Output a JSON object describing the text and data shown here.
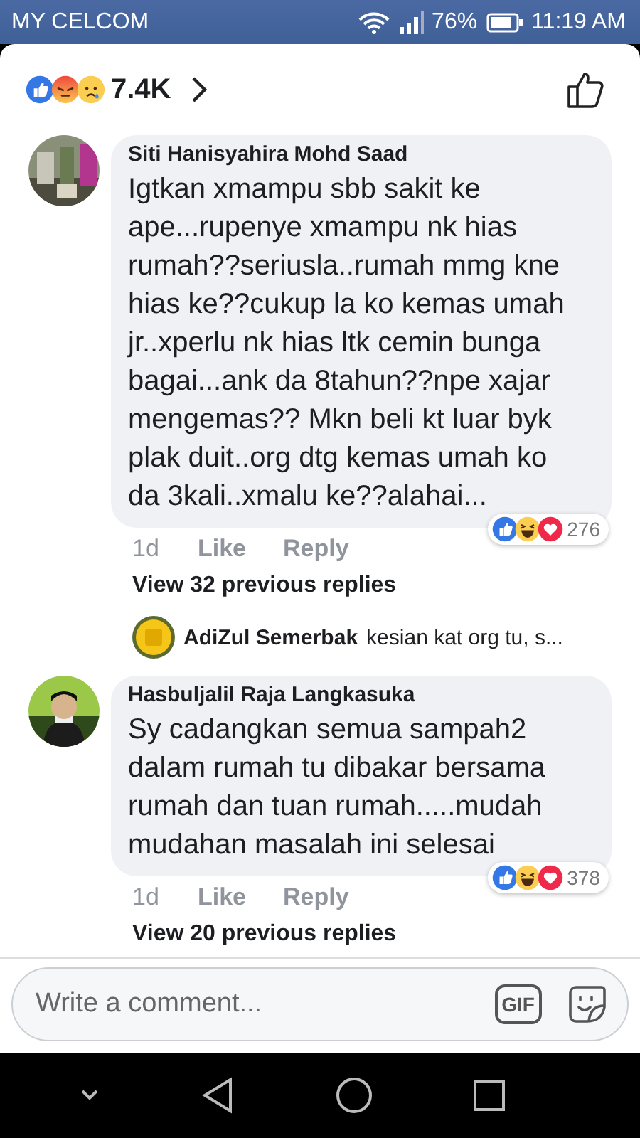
{
  "status_bar": {
    "carrier": "MY CELCOM",
    "battery": "76%",
    "time": "11:19 AM"
  },
  "reactions_header": {
    "reactions": [
      {
        "kind": "like"
      },
      {
        "kind": "angry"
      },
      {
        "kind": "sad"
      }
    ],
    "count": "7.4K"
  },
  "comments": [
    {
      "author": "Siti Hanisyahira Mohd Saad",
      "text": "Igtkan xmampu sbb sakit ke ape...rupenye xmampu nk hias rumah??seriusla..rumah mmg kne hias ke??cukup la ko kemas umah jr..xperlu nk hias ltk cemin bunga bagai...ank da 8tahun??npe xajar mengemas?? Mkn beli kt luar byk plak duit..org dtg kemas umah ko da 3kali..xmalu ke??alahai...",
      "time": "1d",
      "like": "Like",
      "reply": "Reply",
      "reactions": [
        {
          "kind": "like"
        },
        {
          "kind": "haha"
        },
        {
          "kind": "love"
        }
      ],
      "reaction_count": "276",
      "view_replies": "View 32 previous replies",
      "latest_reply": {
        "author": "AdiZul Semerbak",
        "text": "kesian kat org tu, s..."
      }
    },
    {
      "author": "Hasbuljalil Raja Langkasuka",
      "text": "Sy cadangkan semua sampah2 dalam rumah tu dibakar bersama rumah dan tuan rumah.....mudah mudahan masalah ini selesai",
      "time": "1d",
      "like": "Like",
      "reply": "Reply",
      "reactions": [
        {
          "kind": "like"
        },
        {
          "kind": "haha"
        },
        {
          "kind": "love"
        }
      ],
      "reaction_count": "378",
      "view_replies": "View 20 previous replies"
    }
  ],
  "composer": {
    "placeholder": "Write a comment...",
    "gif": "GIF"
  }
}
